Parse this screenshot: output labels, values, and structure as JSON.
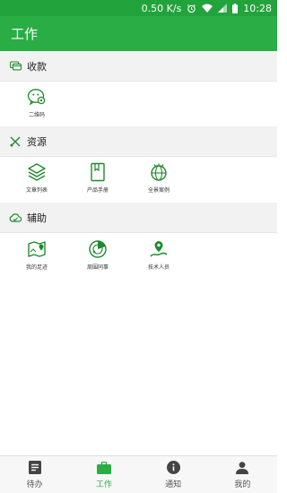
{
  "status_bar": {
    "speed": "0.50 K/s",
    "time": "10:28",
    "icons": [
      "alarm-icon",
      "wifi-icon",
      "signal-icon",
      "battery-icon"
    ]
  },
  "app_bar": {
    "title": "工作"
  },
  "sections": [
    {
      "title": "收款",
      "icon": "payment-icon",
      "items": [
        {
          "label": "二维码",
          "icon": "wechat-icon"
        }
      ]
    },
    {
      "title": "资源",
      "icon": "tools-icon",
      "items": [
        {
          "label": "文章列表",
          "icon": "layers-icon"
        },
        {
          "label": "产品手册",
          "icon": "book-icon"
        },
        {
          "label": "全景案例",
          "icon": "panorama-icon"
        }
      ]
    },
    {
      "title": "辅助",
      "icon": "cloud-icon",
      "items": [
        {
          "label": "我的足迹",
          "icon": "map-icon"
        },
        {
          "label": "周围同事",
          "icon": "radar-icon"
        },
        {
          "label": "技术人员",
          "icon": "technician-icon"
        }
      ]
    }
  ],
  "tabs": [
    {
      "label": "待办",
      "icon": "todo-icon",
      "active": false
    },
    {
      "label": "工作",
      "icon": "briefcase-icon",
      "active": true
    },
    {
      "label": "通知",
      "icon": "info-icon",
      "active": false
    },
    {
      "label": "我的",
      "icon": "person-icon",
      "active": false
    }
  ],
  "colors": {
    "primary": "#2aad45",
    "status_bar": "#23a33b",
    "icon_green": "#1f8a2c"
  }
}
